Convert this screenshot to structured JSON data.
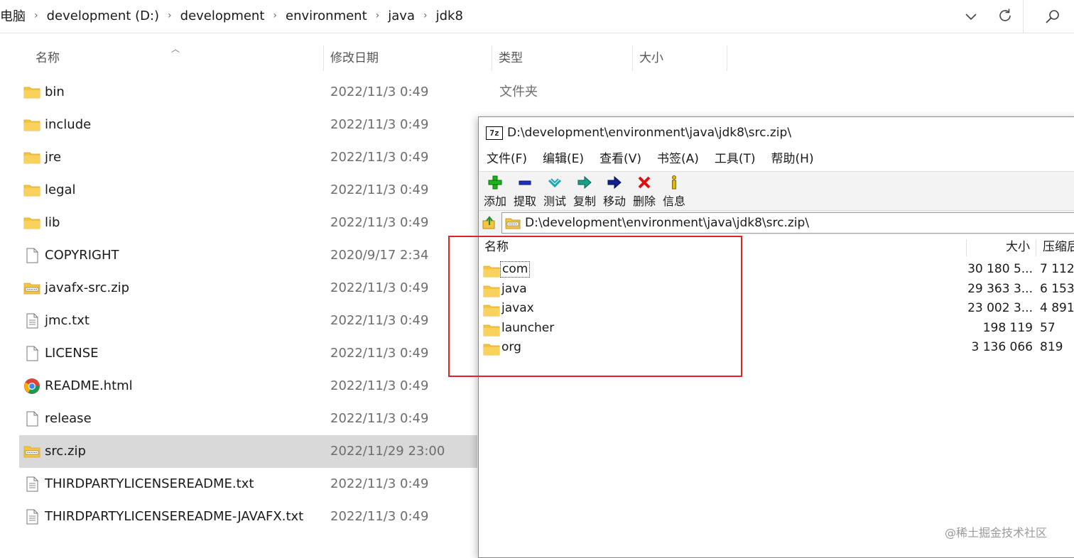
{
  "breadcrumb": [
    "电脑",
    "development (D:)",
    "development",
    "environment",
    "java",
    "jdk8"
  ],
  "columns": {
    "name": "名称",
    "modified": "修改日期",
    "type": "类型",
    "size": "大小"
  },
  "files": [
    {
      "name": "bin",
      "date": "2022/11/3 0:49",
      "type": "文件夹",
      "icon": "folder-icon"
    },
    {
      "name": "include",
      "date": "2022/11/3 0:49",
      "type": "",
      "icon": "folder-icon"
    },
    {
      "name": "jre",
      "date": "2022/11/3 0:49",
      "type": "",
      "icon": "folder-icon"
    },
    {
      "name": "legal",
      "date": "2022/11/3 0:49",
      "type": "",
      "icon": "folder-icon"
    },
    {
      "name": "lib",
      "date": "2022/11/3 0:49",
      "type": "",
      "icon": "folder-icon"
    },
    {
      "name": "COPYRIGHT",
      "date": "2020/9/17 2:34",
      "type": "",
      "icon": "file-icon"
    },
    {
      "name": "javafx-src.zip",
      "date": "2022/11/3 0:49",
      "type": "",
      "icon": "zip-folder-icon"
    },
    {
      "name": "jmc.txt",
      "date": "2022/11/3 0:49",
      "type": "",
      "icon": "text-file-icon"
    },
    {
      "name": "LICENSE",
      "date": "2022/11/3 0:49",
      "type": "",
      "icon": "file-icon"
    },
    {
      "name": "README.html",
      "date": "2022/11/3 0:49",
      "type": "",
      "icon": "chrome-icon"
    },
    {
      "name": "release",
      "date": "2022/11/3 0:49",
      "type": "",
      "icon": "file-icon"
    },
    {
      "name": "src.zip",
      "date": "2022/11/29 23:00",
      "type": "",
      "icon": "zip-folder-icon",
      "selected": true
    },
    {
      "name": "THIRDPARTYLICENSEREADME.txt",
      "date": "2022/11/3 0:49",
      "type": "",
      "icon": "text-file-icon"
    },
    {
      "name": "THIRDPARTYLICENSEREADME-JAVAFX.txt",
      "date": "2022/11/3 0:49",
      "type": "",
      "icon": "text-file-icon"
    }
  ],
  "zip": {
    "logo": "7z",
    "title": "D:\\development\\environment\\java\\jdk8\\src.zip\\",
    "menu": [
      "文件(F)",
      "编辑(E)",
      "查看(V)",
      "书签(A)",
      "工具(T)",
      "帮助(H)"
    ],
    "toolbar": [
      {
        "label": "添加",
        "icon": "add-icon"
      },
      {
        "label": "提取",
        "icon": "extract-icon"
      },
      {
        "label": "测试",
        "icon": "test-icon"
      },
      {
        "label": "复制",
        "icon": "copy-icon"
      },
      {
        "label": "移动",
        "icon": "move-icon"
      },
      {
        "label": "删除",
        "icon": "delete-icon"
      },
      {
        "label": "信息",
        "icon": "info-icon"
      }
    ],
    "path": "D:\\development\\environment\\java\\jdk8\\src.zip\\",
    "columns": {
      "name": "名称",
      "size": "大小",
      "packed": "压缩后"
    },
    "entries": [
      {
        "name": "com",
        "size": "30 180 5...",
        "packed": "7 112"
      },
      {
        "name": "java",
        "size": "29 363 3...",
        "packed": "6 153"
      },
      {
        "name": "javax",
        "size": "23 002 3...",
        "packed": "4 891"
      },
      {
        "name": "launcher",
        "size": "198 119",
        "packed": "57"
      },
      {
        "name": "org",
        "size": "3 136 066",
        "packed": "819"
      }
    ]
  },
  "colors": {
    "highlight": "#e0202a",
    "folder": "#f4c542",
    "selected_row": "#d9d9d9"
  },
  "watermark": "@稀土掘金技术社区"
}
